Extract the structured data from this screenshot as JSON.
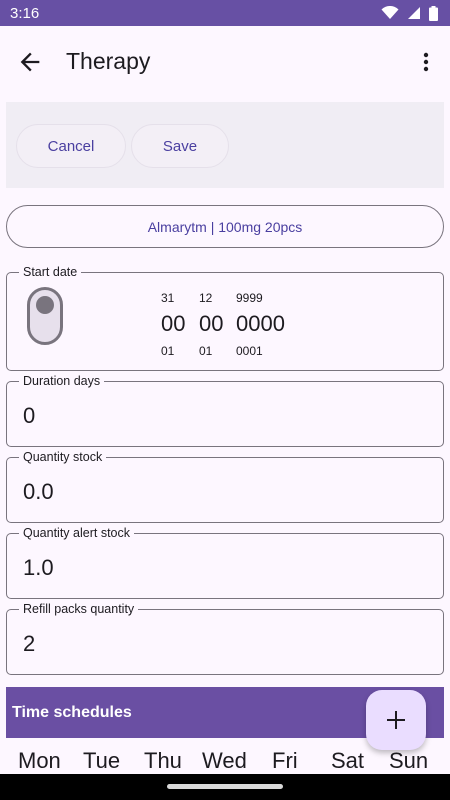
{
  "status_bar": {
    "time": "3:16",
    "icons": [
      "wifi-icon",
      "signal-icon",
      "battery-icon"
    ]
  },
  "top_bar": {
    "title": "Therapy",
    "back_icon": "arrow-left-icon",
    "menu_icon": "more-vert-icon"
  },
  "actions": {
    "cancel_label": "Cancel",
    "save_label": "Save"
  },
  "drug": {
    "label": "Almarytm | 100mg 20pcs"
  },
  "start_date": {
    "label": "Start date",
    "toggle_on": false,
    "day": {
      "prev": "31",
      "current": "00",
      "next": "01"
    },
    "month": {
      "prev": "12",
      "current": "00",
      "next": "01"
    },
    "year": {
      "prev": "9999",
      "current": "0000",
      "next": "0001"
    }
  },
  "fields": {
    "duration": {
      "label": "Duration days",
      "value": "0"
    },
    "quantity_stock": {
      "label": "Quantity stock",
      "value": "0.0"
    },
    "quantity_alert": {
      "label": "Quantity alert stock",
      "value": "1.0"
    },
    "refill": {
      "label": "Refill packs quantity",
      "value": "2"
    }
  },
  "schedules": {
    "title": "Time schedules",
    "weekdays": [
      "Mon",
      "Tue",
      "Thu",
      "Wed",
      "Fri",
      "Sat",
      "Sun"
    ]
  },
  "fab": {
    "icon": "plus-icon"
  },
  "colors": {
    "primary": "#6750a4",
    "header": "#6a4fa3",
    "fab": "#eaddff",
    "accent_text": "#4a3fa0"
  }
}
